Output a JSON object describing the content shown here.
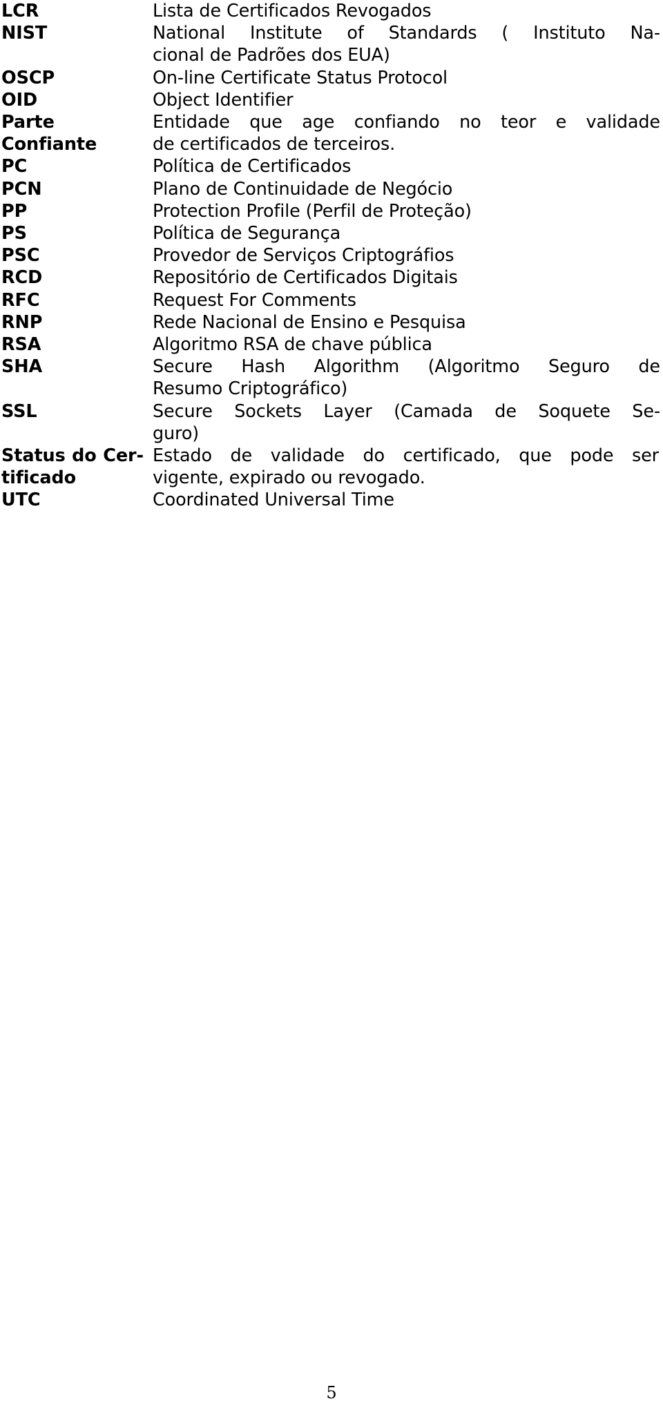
{
  "document": {
    "type": "glossary-page",
    "language": "pt-BR",
    "page_number": "5",
    "text_color": "#000000",
    "background_color": "#ffffff"
  },
  "glossary": {
    "entries": [
      {
        "term": "LCR",
        "definition": "Lista de Certificados Revogados",
        "lines": [
          "Lista de Certificados Revogados"
        ]
      },
      {
        "term": "NIST",
        "definition": "National Institute of Standards ( Instituto Nacional de Padrões dos EUA)",
        "lines": [
          "National Institute of Standards ( Instituto Na-",
          "cional de Padrões dos EUA)"
        ]
      },
      {
        "term": "OSCP",
        "definition": "On-line Certificate Status Protocol",
        "lines": [
          "On-line Certificate Status Protocol"
        ]
      },
      {
        "term": "OID",
        "definition": "Object Identifier",
        "lines": [
          "Object Identifier"
        ]
      },
      {
        "term": "Parte Confiante",
        "definition": "Entidade que age confiando no teor e validade de certificados de terceiros.",
        "lines": [
          "Entidade que age confiando no teor e validade",
          "de certificados de terceiros."
        ]
      },
      {
        "term": "PC",
        "definition": "Política de Certificados",
        "lines": [
          "Política de Certificados"
        ]
      },
      {
        "term": "PCN",
        "definition": "Plano de Continuidade de Negócio",
        "lines": [
          "Plano de Continuidade de Negócio"
        ]
      },
      {
        "term": "PP",
        "definition": "Protection Profile (Perfil de Proteção)",
        "lines": [
          "Protection Profile (Perfil de Proteção)"
        ]
      },
      {
        "term": "PS",
        "definition": "Política de Segurança",
        "lines": [
          "Política de Segurança"
        ]
      },
      {
        "term": "PSC",
        "definition": "Provedor de Serviços Criptográfios",
        "lines": [
          "Provedor de Serviços Criptográfios"
        ]
      },
      {
        "term": "RCD",
        "definition": "Repositório de Certificados Digitais",
        "lines": [
          "Repositório de Certificados Digitais"
        ]
      },
      {
        "term": "RFC",
        "definition": "Request For Comments",
        "lines": [
          "Request For Comments"
        ]
      },
      {
        "term": "RNP",
        "definition": "Rede Nacional de Ensino e Pesquisa",
        "lines": [
          "Rede Nacional de Ensino e Pesquisa"
        ]
      },
      {
        "term": "RSA",
        "definition": "Algoritmo RSA de chave pública",
        "lines": [
          "Algoritmo RSA de chave pública"
        ]
      },
      {
        "term": "SHA",
        "definition": "Secure Hash Algorithm (Algoritmo Seguro de Resumo Criptográfico)",
        "lines": [
          "Secure Hash Algorithm (Algoritmo Seguro de",
          "Resumo Criptográfico)"
        ]
      },
      {
        "term": "SSL",
        "definition": "Secure Sockets Layer (Camada de Soquete Seguro)",
        "lines": [
          "Secure Sockets Layer (Camada de Soquete Se-",
          "guro)"
        ]
      },
      {
        "term": "Status do Certificado",
        "term_lines": [
          "Status do Cer-",
          "tificado"
        ],
        "definition": "Estado de validade do certificado, que pode ser vigente, expirado ou revogado.",
        "lines": [
          "Estado de validade do certificado, que pode ser",
          "vigente, expirado ou revogado."
        ]
      },
      {
        "term": "UTC",
        "definition": "Coordinated Universal Time",
        "lines": [
          "Coordinated Universal Time"
        ]
      }
    ]
  }
}
